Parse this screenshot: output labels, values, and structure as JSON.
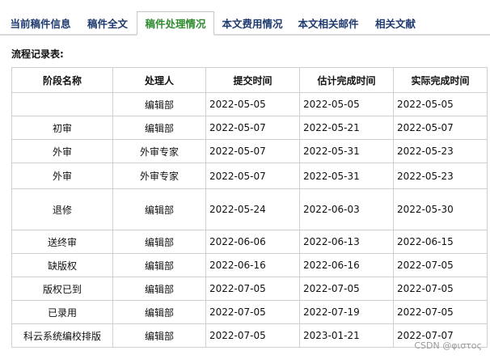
{
  "tabs": [
    {
      "label": "当前稿件信息",
      "active": false
    },
    {
      "label": "稿件全文",
      "active": false
    },
    {
      "label": "稿件处理情况",
      "active": true
    },
    {
      "label": "本文费用情况",
      "active": false
    },
    {
      "label": "本文相关邮件",
      "active": false
    },
    {
      "label": "相关文献",
      "active": false
    }
  ],
  "section_title": "流程记录表:",
  "table": {
    "headers": [
      "阶段名称",
      "处理人",
      "提交时间",
      "估计完成时间",
      "实际完成时间"
    ],
    "rows": [
      [
        "",
        "编辑部",
        "2022-05-05",
        "2022-05-05",
        "2022-05-05"
      ],
      [
        "初审",
        "编辑部",
        "2022-05-07",
        "2022-05-21",
        "2022-05-07"
      ],
      [
        "外审",
        "外审专家",
        "2022-05-07",
        "2022-05-31",
        "2022-05-23"
      ],
      [
        "外审",
        "外审专家",
        "2022-05-07",
        "2022-05-31",
        "2022-05-23"
      ],
      [
        "退修",
        "编辑部",
        "2022-05-24",
        "2022-06-03",
        "2022-05-30"
      ],
      [
        "送终审",
        "编辑部",
        "2022-06-06",
        "2022-06-13",
        "2022-06-15"
      ],
      [
        "缺版权",
        "编辑部",
        "2022-06-16",
        "2022-06-16",
        "2022-07-05"
      ],
      [
        "版权已到",
        "编辑部",
        "2022-07-05",
        "2022-07-05",
        "2022-07-05"
      ],
      [
        "已录用",
        "编辑部",
        "2022-07-05",
        "2022-07-19",
        "2022-07-05"
      ],
      [
        "科云系统编校排版",
        "编辑部",
        "2022-07-05",
        "2023-01-21",
        "2022-07-07"
      ]
    ]
  },
  "watermark": "CSDN @φιστος"
}
